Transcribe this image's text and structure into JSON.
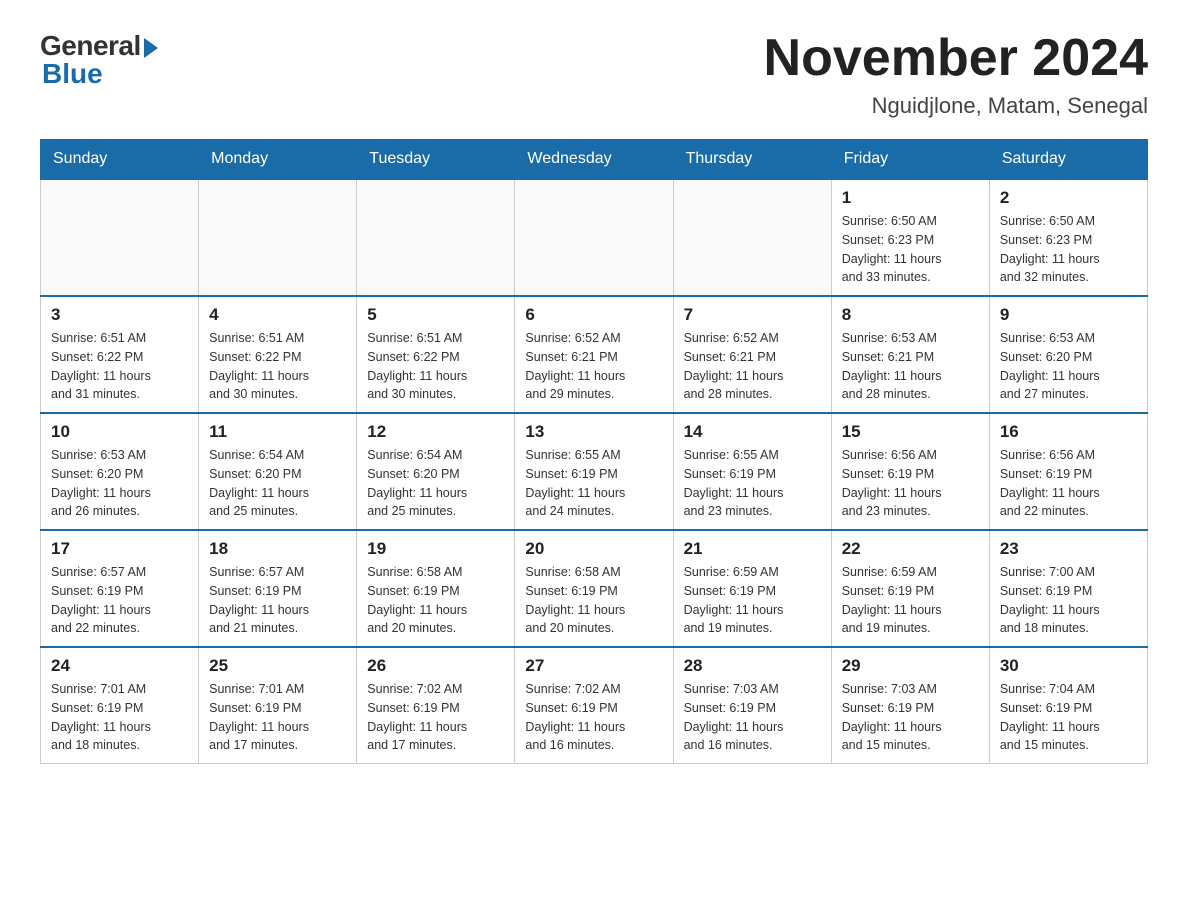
{
  "logo": {
    "general": "General",
    "blue": "Blue"
  },
  "title": {
    "month_year": "November 2024",
    "location": "Nguidjlone, Matam, Senegal"
  },
  "days_of_week": [
    "Sunday",
    "Monday",
    "Tuesday",
    "Wednesday",
    "Thursday",
    "Friday",
    "Saturday"
  ],
  "weeks": [
    [
      {
        "day": "",
        "info": ""
      },
      {
        "day": "",
        "info": ""
      },
      {
        "day": "",
        "info": ""
      },
      {
        "day": "",
        "info": ""
      },
      {
        "day": "",
        "info": ""
      },
      {
        "day": "1",
        "info": "Sunrise: 6:50 AM\nSunset: 6:23 PM\nDaylight: 11 hours\nand 33 minutes."
      },
      {
        "day": "2",
        "info": "Sunrise: 6:50 AM\nSunset: 6:23 PM\nDaylight: 11 hours\nand 32 minutes."
      }
    ],
    [
      {
        "day": "3",
        "info": "Sunrise: 6:51 AM\nSunset: 6:22 PM\nDaylight: 11 hours\nand 31 minutes."
      },
      {
        "day": "4",
        "info": "Sunrise: 6:51 AM\nSunset: 6:22 PM\nDaylight: 11 hours\nand 30 minutes."
      },
      {
        "day": "5",
        "info": "Sunrise: 6:51 AM\nSunset: 6:22 PM\nDaylight: 11 hours\nand 30 minutes."
      },
      {
        "day": "6",
        "info": "Sunrise: 6:52 AM\nSunset: 6:21 PM\nDaylight: 11 hours\nand 29 minutes."
      },
      {
        "day": "7",
        "info": "Sunrise: 6:52 AM\nSunset: 6:21 PM\nDaylight: 11 hours\nand 28 minutes."
      },
      {
        "day": "8",
        "info": "Sunrise: 6:53 AM\nSunset: 6:21 PM\nDaylight: 11 hours\nand 28 minutes."
      },
      {
        "day": "9",
        "info": "Sunrise: 6:53 AM\nSunset: 6:20 PM\nDaylight: 11 hours\nand 27 minutes."
      }
    ],
    [
      {
        "day": "10",
        "info": "Sunrise: 6:53 AM\nSunset: 6:20 PM\nDaylight: 11 hours\nand 26 minutes."
      },
      {
        "day": "11",
        "info": "Sunrise: 6:54 AM\nSunset: 6:20 PM\nDaylight: 11 hours\nand 25 minutes."
      },
      {
        "day": "12",
        "info": "Sunrise: 6:54 AM\nSunset: 6:20 PM\nDaylight: 11 hours\nand 25 minutes."
      },
      {
        "day": "13",
        "info": "Sunrise: 6:55 AM\nSunset: 6:19 PM\nDaylight: 11 hours\nand 24 minutes."
      },
      {
        "day": "14",
        "info": "Sunrise: 6:55 AM\nSunset: 6:19 PM\nDaylight: 11 hours\nand 23 minutes."
      },
      {
        "day": "15",
        "info": "Sunrise: 6:56 AM\nSunset: 6:19 PM\nDaylight: 11 hours\nand 23 minutes."
      },
      {
        "day": "16",
        "info": "Sunrise: 6:56 AM\nSunset: 6:19 PM\nDaylight: 11 hours\nand 22 minutes."
      }
    ],
    [
      {
        "day": "17",
        "info": "Sunrise: 6:57 AM\nSunset: 6:19 PM\nDaylight: 11 hours\nand 22 minutes."
      },
      {
        "day": "18",
        "info": "Sunrise: 6:57 AM\nSunset: 6:19 PM\nDaylight: 11 hours\nand 21 minutes."
      },
      {
        "day": "19",
        "info": "Sunrise: 6:58 AM\nSunset: 6:19 PM\nDaylight: 11 hours\nand 20 minutes."
      },
      {
        "day": "20",
        "info": "Sunrise: 6:58 AM\nSunset: 6:19 PM\nDaylight: 11 hours\nand 20 minutes."
      },
      {
        "day": "21",
        "info": "Sunrise: 6:59 AM\nSunset: 6:19 PM\nDaylight: 11 hours\nand 19 minutes."
      },
      {
        "day": "22",
        "info": "Sunrise: 6:59 AM\nSunset: 6:19 PM\nDaylight: 11 hours\nand 19 minutes."
      },
      {
        "day": "23",
        "info": "Sunrise: 7:00 AM\nSunset: 6:19 PM\nDaylight: 11 hours\nand 18 minutes."
      }
    ],
    [
      {
        "day": "24",
        "info": "Sunrise: 7:01 AM\nSunset: 6:19 PM\nDaylight: 11 hours\nand 18 minutes."
      },
      {
        "day": "25",
        "info": "Sunrise: 7:01 AM\nSunset: 6:19 PM\nDaylight: 11 hours\nand 17 minutes."
      },
      {
        "day": "26",
        "info": "Sunrise: 7:02 AM\nSunset: 6:19 PM\nDaylight: 11 hours\nand 17 minutes."
      },
      {
        "day": "27",
        "info": "Sunrise: 7:02 AM\nSunset: 6:19 PM\nDaylight: 11 hours\nand 16 minutes."
      },
      {
        "day": "28",
        "info": "Sunrise: 7:03 AM\nSunset: 6:19 PM\nDaylight: 11 hours\nand 16 minutes."
      },
      {
        "day": "29",
        "info": "Sunrise: 7:03 AM\nSunset: 6:19 PM\nDaylight: 11 hours\nand 15 minutes."
      },
      {
        "day": "30",
        "info": "Sunrise: 7:04 AM\nSunset: 6:19 PM\nDaylight: 11 hours\nand 15 minutes."
      }
    ]
  ]
}
